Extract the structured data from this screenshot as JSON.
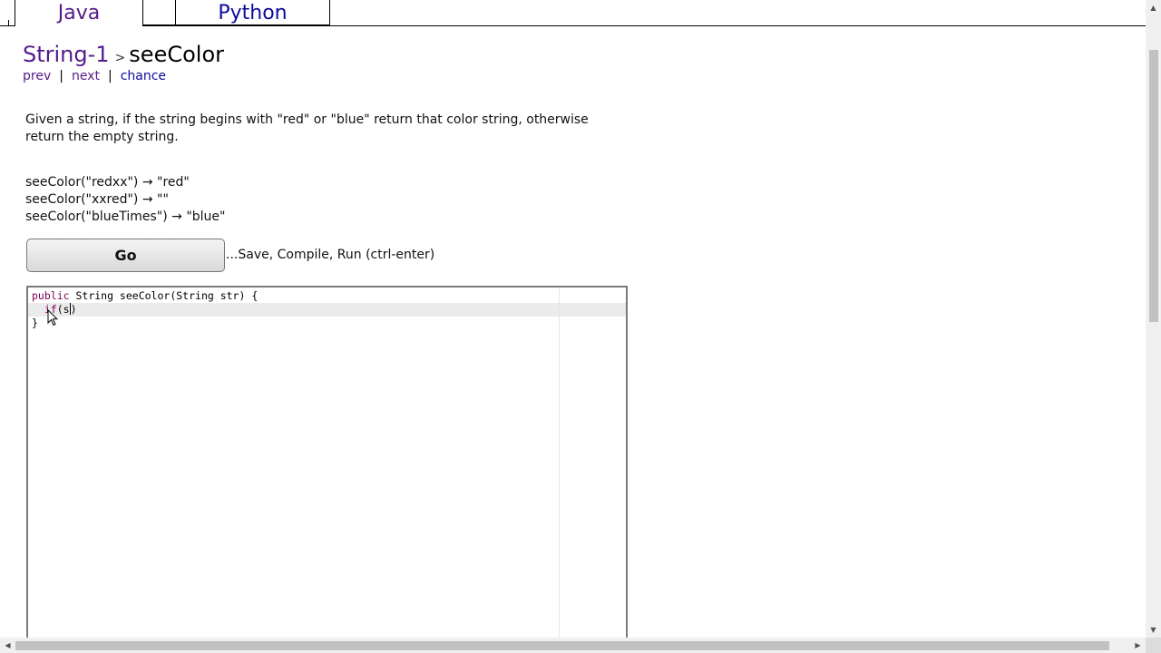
{
  "tabs": {
    "java": "Java",
    "python": "Python"
  },
  "breadcrumb": {
    "section": "String-1",
    "separator": ">",
    "problem": "seeColor"
  },
  "nav": {
    "prev": "prev",
    "next": "next",
    "chance": "chance",
    "divider": "|"
  },
  "description": "Given a string, if the string begins with \"red\" or \"blue\" return that color string, otherwise return the empty string.",
  "examples": [
    "seeColor(\"redxx\") → \"red\"",
    "seeColor(\"xxred\") → \"\"",
    "seeColor(\"blueTimes\") → \"blue\""
  ],
  "go": {
    "label": "Go",
    "hint": "...Save, Compile, Run (ctrl-enter)"
  },
  "editor": {
    "line1_kw": "public",
    "line1_rest": " String seeColor(String str) {",
    "line2_indent": "  ",
    "line2_kw": "if",
    "line2_rest": "(s",
    "line2_after": ")",
    "line3": "}"
  },
  "scrollbars": {
    "up": "▲",
    "down": "▼",
    "left": "◀",
    "right": "▶"
  },
  "colors": {
    "visited_link": "#551a8b",
    "link": "#0b0b9a",
    "keyword": "#7f0055"
  }
}
